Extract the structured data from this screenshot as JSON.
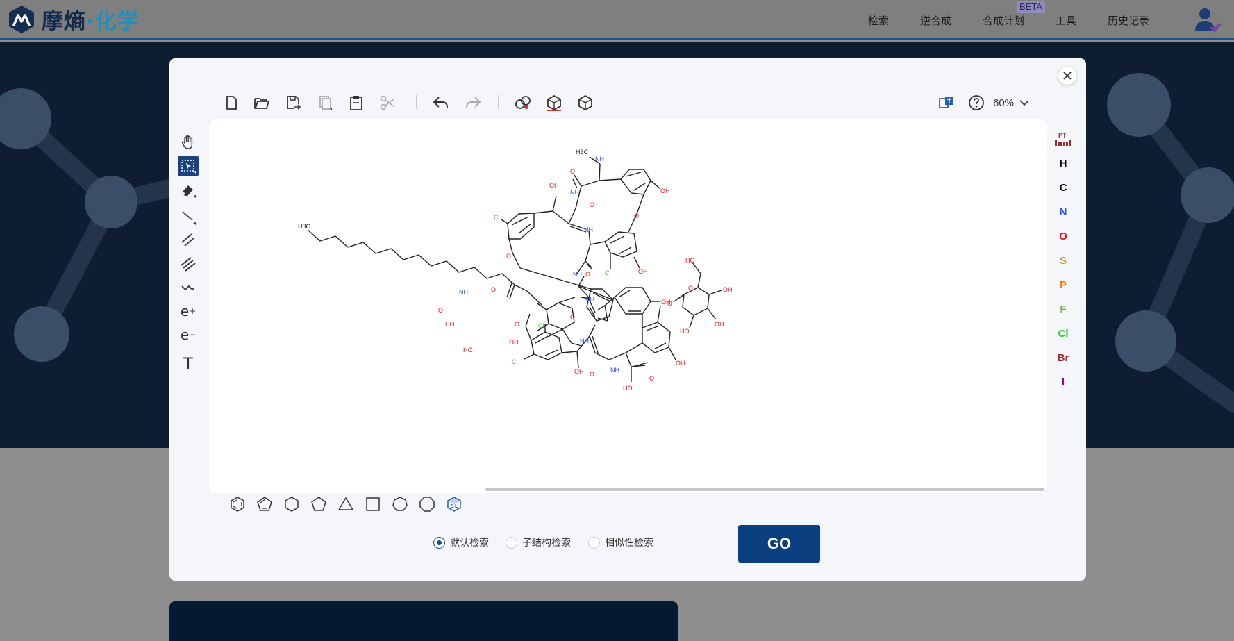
{
  "app": {
    "logo_text_a": "摩熵",
    "logo_text_b": "·化学"
  },
  "nav": {
    "items": [
      "检索",
      "逆合成",
      "合成计划",
      "工具",
      "历史记录"
    ],
    "beta_badge": "BETA"
  },
  "editor": {
    "zoom_level": "60%",
    "toolbar_icons": [
      "new-file-icon",
      "open-file-icon",
      "save-file-icon",
      "copy-icon",
      "paste-icon",
      "cut-icon",
      "undo-icon",
      "redo-icon",
      "clean-up-icon",
      "3d-structure-icon",
      "3d-view-icon",
      "language-switch-icon",
      "help-icon"
    ],
    "left_tools": {
      "charge_plus": "e",
      "charge_plus_sup": "+",
      "charge_minus": "e",
      "charge_minus_sup": "−",
      "text_tool": "T"
    },
    "periodic_table_label": "PT",
    "elements": [
      {
        "symbol": "H",
        "color": "#000000"
      },
      {
        "symbol": "C",
        "color": "#000000"
      },
      {
        "symbol": "N",
        "color": "#304ff7"
      },
      {
        "symbol": "O",
        "color": "#ff0d0d"
      },
      {
        "symbol": "S",
        "color": "#c99a2e"
      },
      {
        "symbol": "P",
        "color": "#ff8000"
      },
      {
        "symbol": "F",
        "color": "#78b536"
      },
      {
        "symbol": "Cl",
        "color": "#1fd01f"
      },
      {
        "symbol": "Br",
        "color": "#a62929"
      },
      {
        "symbol": "I",
        "color": "#940094"
      }
    ],
    "molecule_labels": {
      "h3c_top": "H3C",
      "nh": "NH",
      "o": "O",
      "oh": "OH",
      "cl": "Cl",
      "h3c_chain": "H3C",
      "ho": "HO"
    }
  },
  "search": {
    "options": [
      "默认检索",
      "子结构检索",
      "相似性检索"
    ],
    "selected_index": 0,
    "go_label": "GO"
  },
  "colors": {
    "accent": "#0b3f80",
    "brand_dark": "#122a4c",
    "brand_light": "#1f8fbd",
    "nitrogen": "#304ff7",
    "oxygen": "#ff0d0d",
    "chlorine": "#1fd01f"
  }
}
